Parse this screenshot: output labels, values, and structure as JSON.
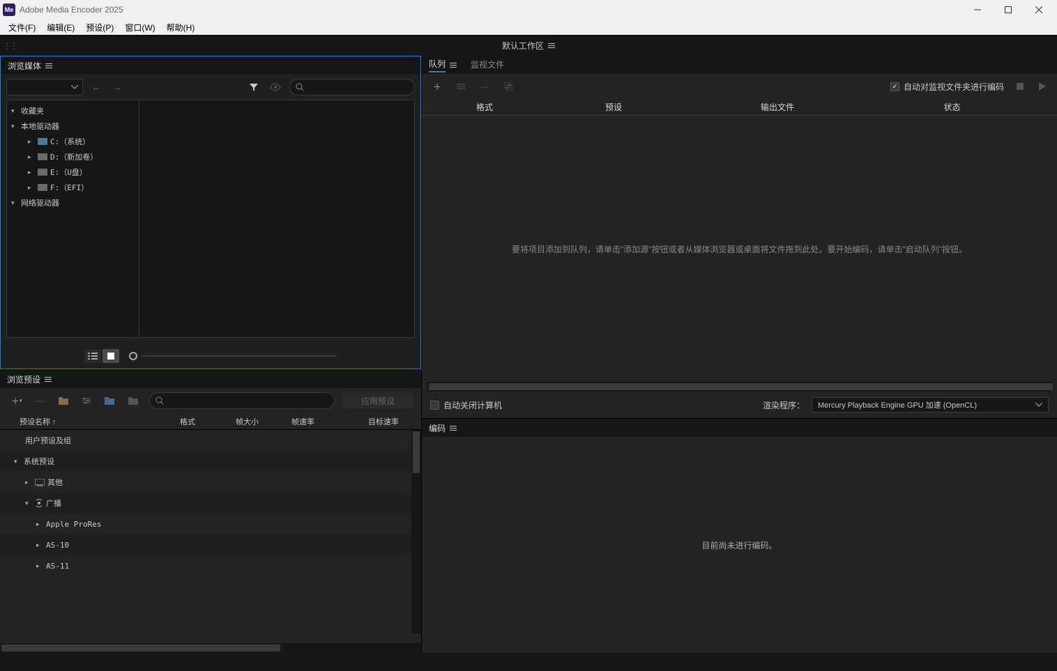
{
  "titlebar": {
    "app_icon_text": "Me",
    "title": "Adobe Media Encoder 2025"
  },
  "menubar": {
    "items": [
      "文件(F)",
      "编辑(E)",
      "预设(P)",
      "窗口(W)",
      "帮助(H)"
    ]
  },
  "workspace": {
    "label": "默认工作区"
  },
  "browse_media": {
    "title": "浏览媒体",
    "tree": {
      "favorites": "收藏夹",
      "local_drives": "本地驱动器",
      "drives": [
        {
          "label": "C:（系统）"
        },
        {
          "label": "D:（新加卷）"
        },
        {
          "label": "E:（U盘）"
        },
        {
          "label": "F:（EFI）"
        }
      ],
      "network_drives": "网络驱动器"
    }
  },
  "preset_browser": {
    "title": "浏览预设",
    "apply_label": "应用预设",
    "columns": {
      "name": "预设名称 ↑",
      "format": "格式",
      "frame_size": "帧大小",
      "frame_rate": "帧速率",
      "target_rate": "目标速率"
    },
    "rows": {
      "user_presets": "用户预设及组",
      "system_presets": "系统预设",
      "other": "其他",
      "broadcast": "广播",
      "apple_prores": "Apple ProRes",
      "as10": "AS-10",
      "as11": "AS-11"
    }
  },
  "queue": {
    "tab_queue": "队列",
    "tab_watch": "监视文件",
    "auto_encode_label": "自动对监视文件夹进行编码",
    "columns": {
      "format": "格式",
      "preset": "预设",
      "output": "输出文件",
      "status": "状态"
    },
    "empty_message": "要将项目添加到队列，请单击\"添加源\"按钮或者从媒体浏览器或桌面将文件拖到此处。要开始编码，请单击\"启动队列\"按钮。",
    "auto_shutdown": "自动关闭计算机",
    "renderer_label": "渲染程序：",
    "renderer_value": "Mercury Playback Engine GPU 加速 (OpenCL)"
  },
  "encoding": {
    "title": "编码",
    "empty_message": "目前尚未进行编码。"
  }
}
